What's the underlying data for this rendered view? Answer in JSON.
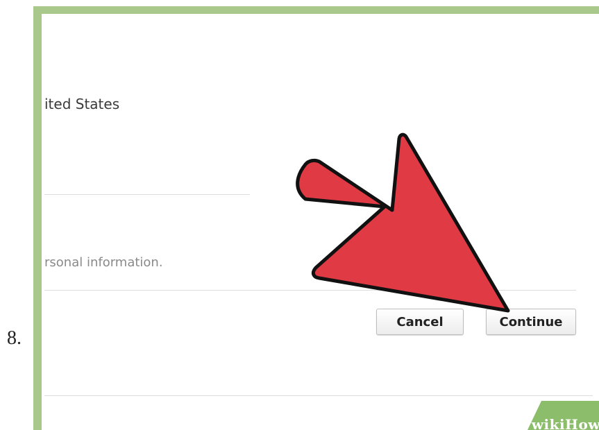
{
  "step": {
    "number": "8."
  },
  "form": {
    "country_text": "ited States",
    "info_text": "rsonal information."
  },
  "buttons": {
    "cancel_label": "Cancel",
    "continue_label": "Continue"
  },
  "branding": {
    "logo_wiki": "wiki",
    "logo_how": "How"
  },
  "colors": {
    "frame_green": "#a8c98b",
    "arrow_red": "#e03a45",
    "banner_green": "#8cbd6a"
  }
}
